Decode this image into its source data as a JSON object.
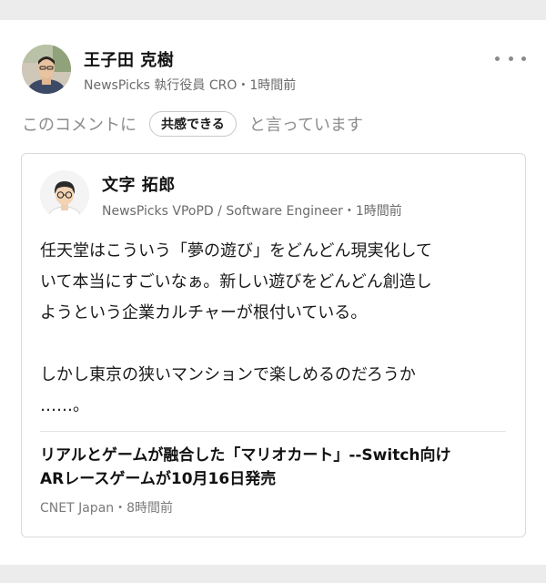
{
  "post": {
    "author_name": "王子田 克樹",
    "author_meta": "NewsPicks 執行役員 CRO・1時間前",
    "empathy_prefix": "このコメントに",
    "empathy_badge": "共感できる",
    "empathy_suffix": "と言っています"
  },
  "quoted_comment": {
    "author_name": "文字 拓郎",
    "author_meta": "NewsPicks VPoPD / Software Engineer・1時間前",
    "body_paragraph_1_lines": [
      "任天堂はこういう「夢の遊び」をどんどん現実化して",
      "いて本当にすごいなぁ。新しい遊びをどんどん創造し",
      "ようという企業カルチャーが根付いている。"
    ],
    "body_paragraph_2_lines": [
      "しかし東京の狭いマンションで楽しめるのだろうか",
      "……。"
    ]
  },
  "article": {
    "title_lines": [
      "リアルとゲームが融合した「マリオカート」--Switch向け",
      "ARレースゲームが10月16日発売"
    ],
    "source": "CNET Japan・8時間前"
  },
  "icons": {
    "more": "more-horizontal-icon"
  },
  "colors": {
    "background": "#ececec",
    "card": "#ffffff",
    "meta_text": "#6b6b6b",
    "border": "#dadada"
  }
}
